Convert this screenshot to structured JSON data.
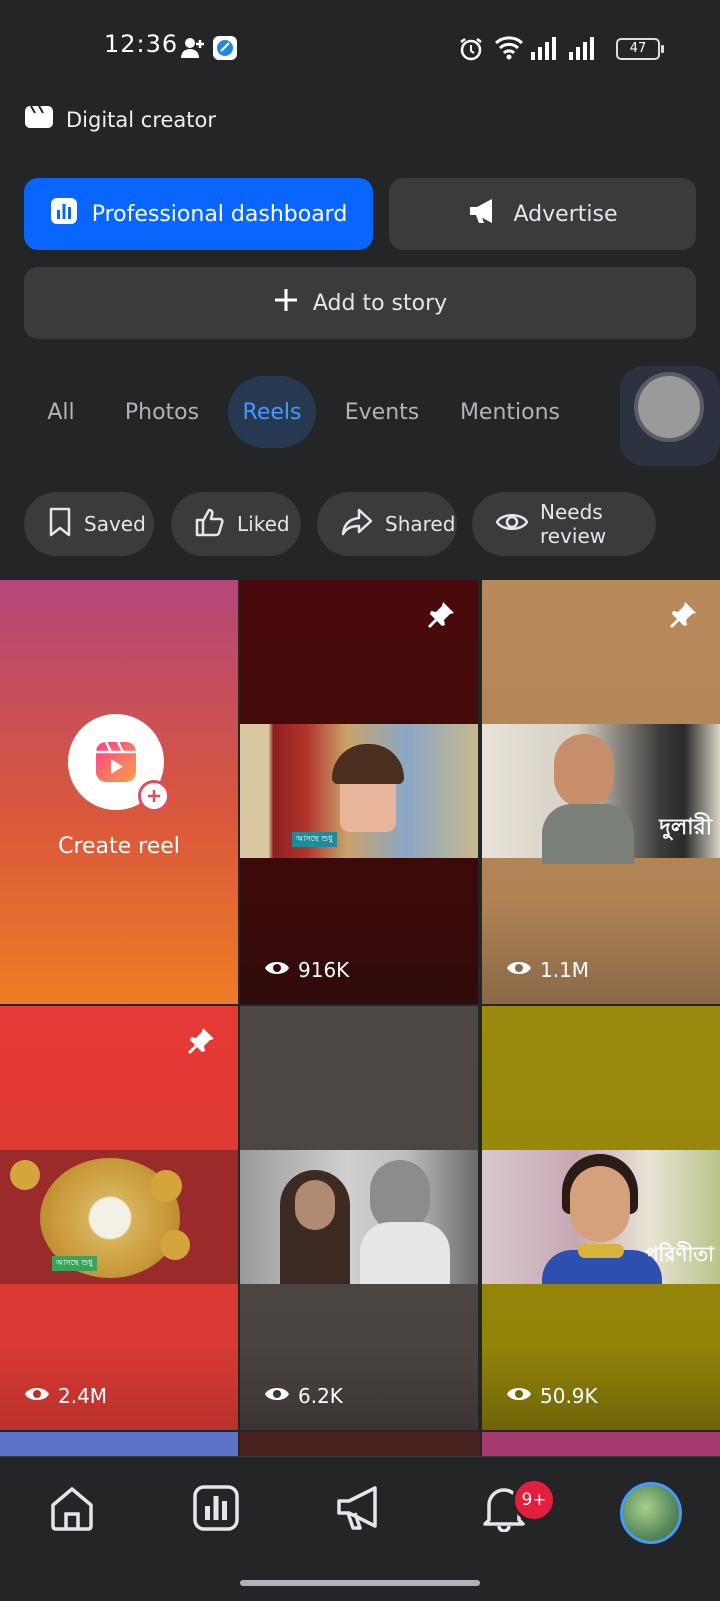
{
  "status_bar": {
    "time": "12:36",
    "battery": "47"
  },
  "header": {
    "account_type": "Digital creator"
  },
  "actions": {
    "professional_dashboard": "Professional dashboard",
    "advertise": "Advertise",
    "add_to_story": "Add to story"
  },
  "tabs": [
    {
      "label": "All"
    },
    {
      "label": "Photos"
    },
    {
      "label": "Reels",
      "active": true
    },
    {
      "label": "Events"
    },
    {
      "label": "Mentions"
    }
  ],
  "filters": [
    {
      "label": "Saved",
      "icon": "bookmark-icon"
    },
    {
      "label": "Liked",
      "icon": "thumbs-up-icon"
    },
    {
      "label": "Shared",
      "icon": "share-icon"
    },
    {
      "label": "Needs review",
      "icon": "eye-icon"
    }
  ],
  "create_reel": {
    "label": "Create reel"
  },
  "reels": [
    {
      "views": "916K",
      "pinned": true,
      "bg": "#4a0a0c",
      "caption": "আসছে শুধু"
    },
    {
      "views": "1.1M",
      "pinned": true,
      "bg": "#b8895a",
      "caption": "দুলারী"
    },
    {
      "views": "2.4M",
      "pinned": true,
      "bg": "#e53935",
      "caption": "আসছে শুধু"
    },
    {
      "views": "6.2K",
      "pinned": false,
      "bg": "#4e4845",
      "caption": ""
    },
    {
      "views": "50.9K",
      "pinned": false,
      "bg": "#9a8b0e",
      "caption": "পরিণীতা"
    }
  ],
  "bottom_nav": {
    "notifications_badge": "9+"
  },
  "colors": {
    "accent": "#0866ff",
    "background": "#242526",
    "surface": "#3a3b3c",
    "active_tab_text": "#4599ff"
  }
}
